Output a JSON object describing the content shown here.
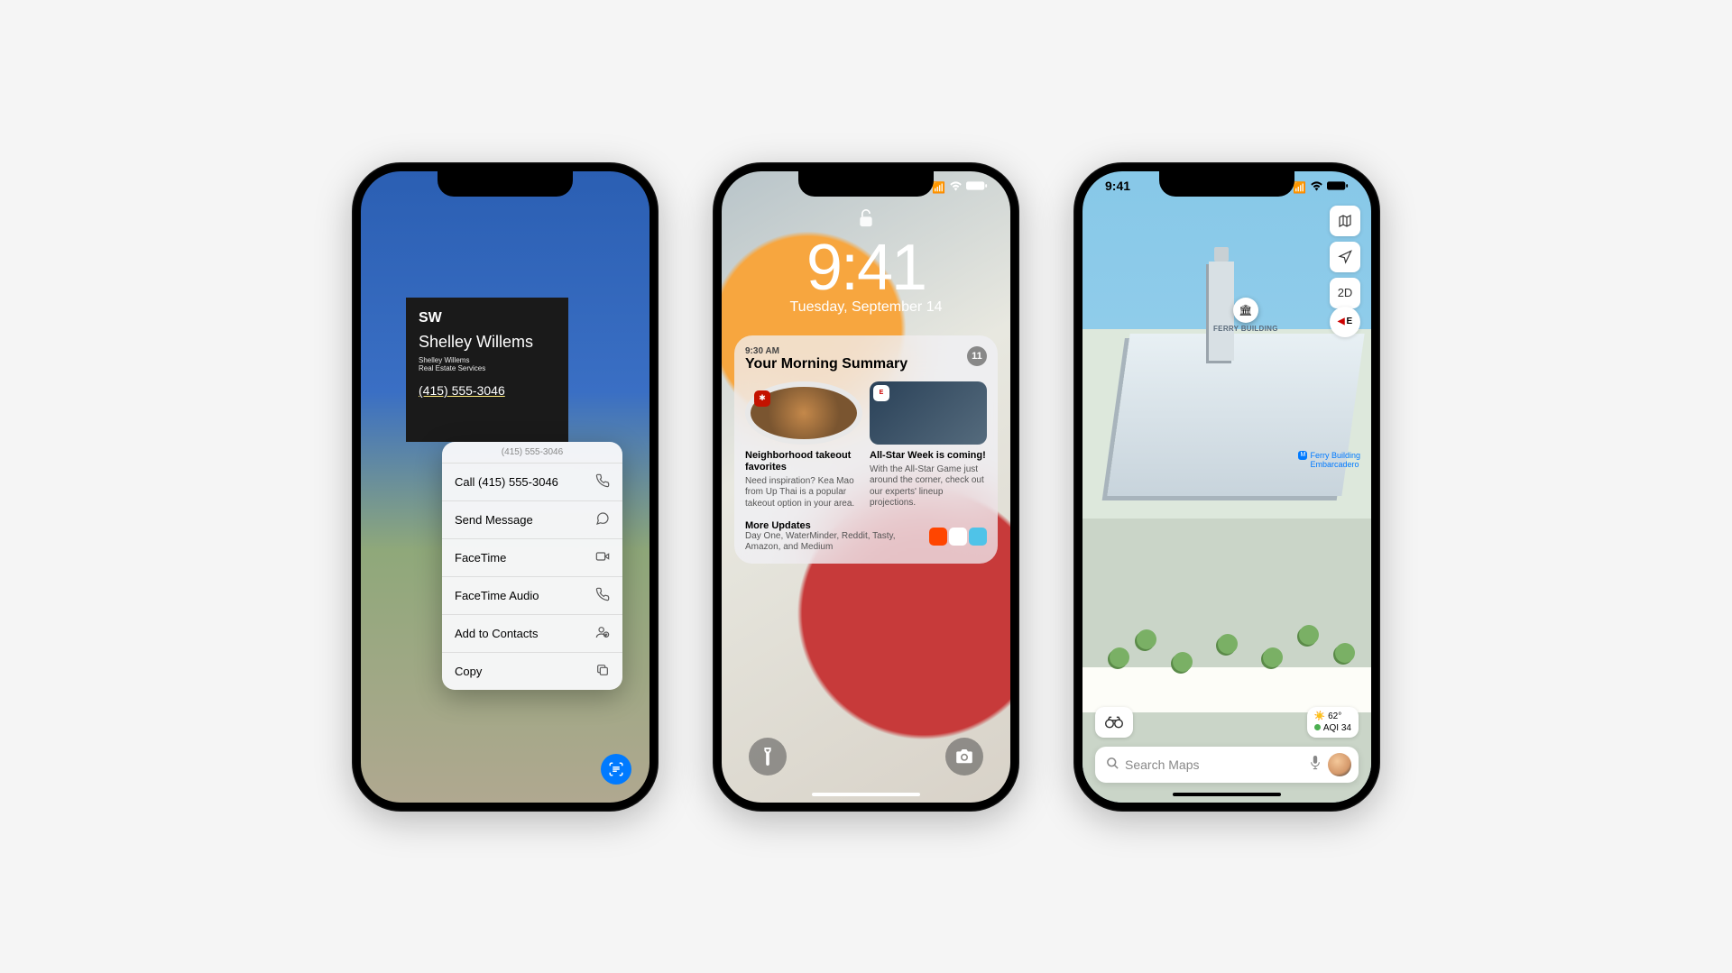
{
  "status": {
    "time": "9:41"
  },
  "phone1": {
    "sign": {
      "logo": "SW",
      "name": "Shelley Willems",
      "sub1": "Shelley Willems",
      "sub2": "Real Estate Services",
      "phone": "(415) 555-3046"
    },
    "menu": {
      "header": "(415) 555-3046",
      "items": [
        {
          "label": "Call (415) 555-3046",
          "icon": "phone"
        },
        {
          "label": "Send Message",
          "icon": "message"
        },
        {
          "label": "FaceTime",
          "icon": "video"
        },
        {
          "label": "FaceTime Audio",
          "icon": "phone"
        },
        {
          "label": "Add to Contacts",
          "icon": "contact"
        },
        {
          "label": "Copy",
          "icon": "copy"
        }
      ]
    }
  },
  "phone2": {
    "clock": "9:41",
    "date": "Tuesday, September 14",
    "summary": {
      "time": "9:30 AM",
      "title": "Your Morning Summary",
      "count": "11",
      "items": [
        {
          "title": "Neighborhood takeout favorites",
          "body": "Need inspiration? Kea Mao from Up Thai is a popular takeout option in your area."
        },
        {
          "title": "All-Star Week is coming!",
          "body": "With the All-Star Game just around the corner, check out our experts' lineup projections."
        }
      ],
      "more_title": "More Updates",
      "more_body": "Day One, WaterMinder, Reddit, Tasty, Amazon, and Medium"
    }
  },
  "phone3": {
    "controls": {
      "mode": "2D"
    },
    "compass": "E",
    "poi": {
      "name": "FERRY BUILDING"
    },
    "station": {
      "name": "Ferry Building",
      "line": "Embarcadero"
    },
    "weather": {
      "temp": "62°",
      "aqi_label": "AQI 34"
    },
    "search": {
      "placeholder": "Search Maps"
    }
  }
}
